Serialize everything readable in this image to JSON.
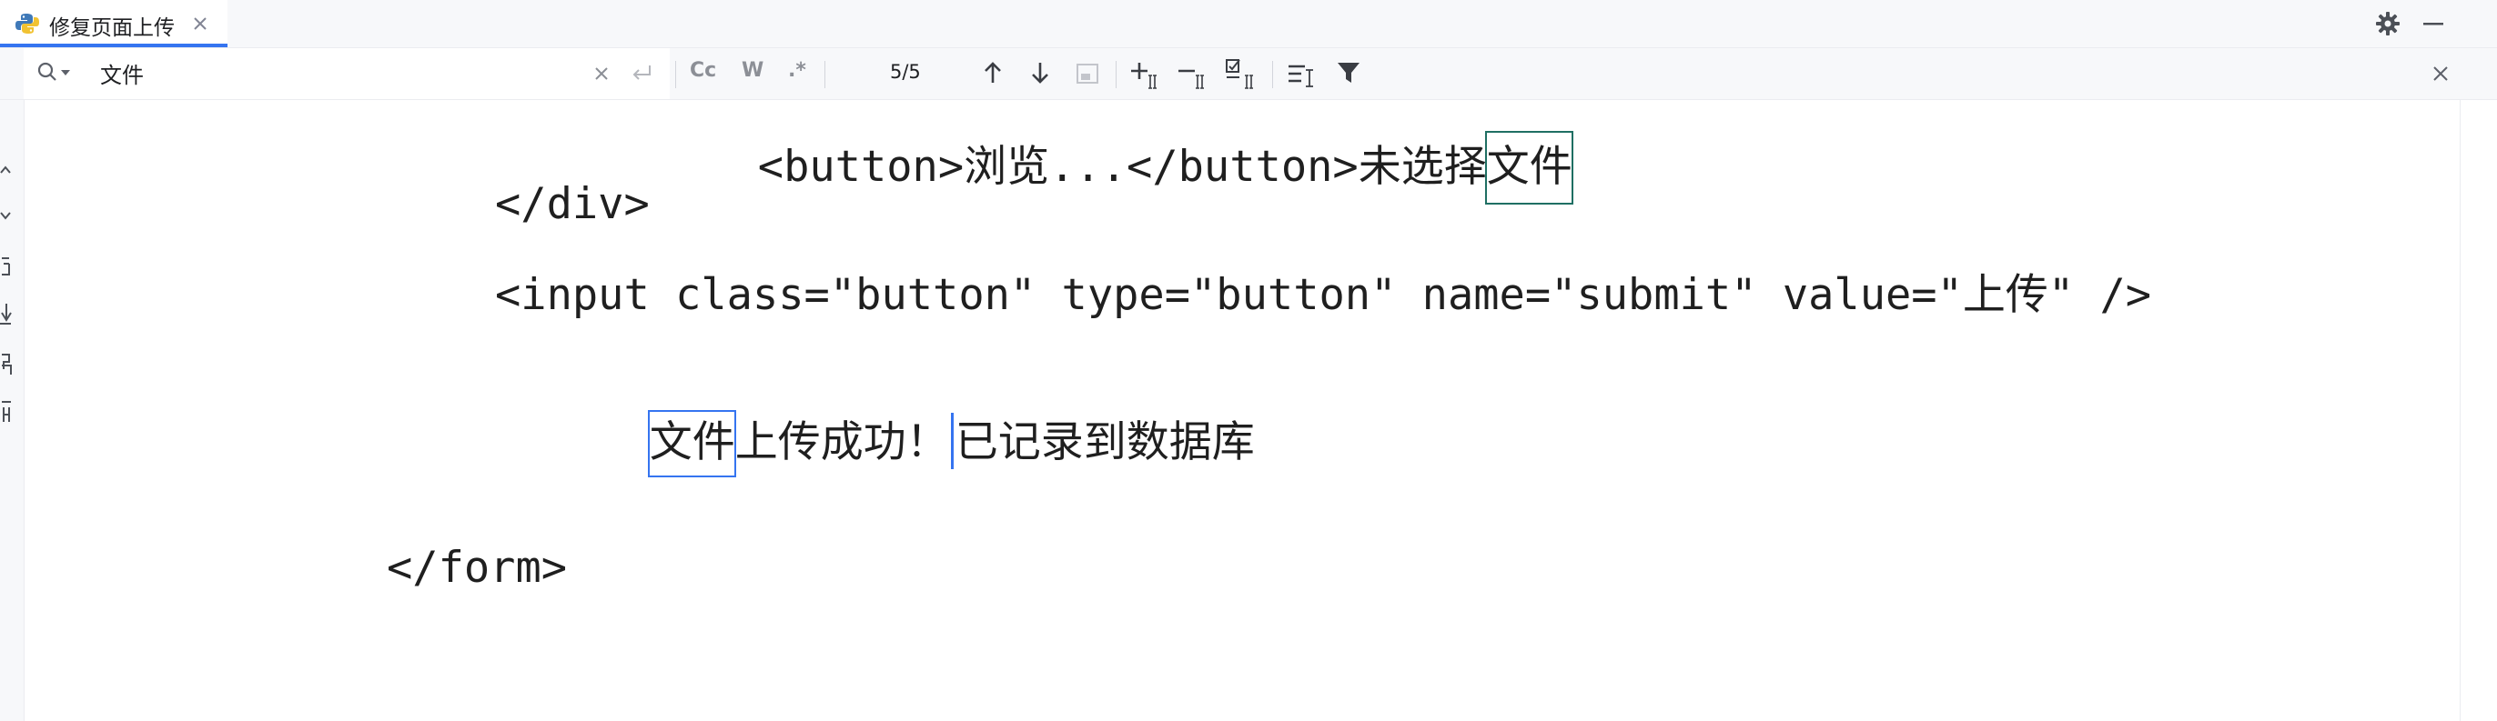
{
  "tab": {
    "icon": "python-file-icon",
    "label": "修复页面上传"
  },
  "find": {
    "query": "文件",
    "match_count": "5/5",
    "case_label": "Cc",
    "words_label": "W",
    "regex_label": ".*"
  },
  "code": {
    "line1": {
      "before": "<button>浏览...</button>未选择",
      "match": "文件"
    },
    "line2": "</div>",
    "line3": "<input class=\"button\" type=\"button\" name=\"submit\" value=\"上传\" />",
    "line4": {
      "match": "文件",
      "before_caret": "上传成功！",
      "after_caret": "已记录到数据库"
    },
    "line5": "</form>"
  },
  "colors": {
    "accent": "#3574f0",
    "other_match": "#1f6f63",
    "text": "#1f1f1f",
    "panel": "#f7f8fa"
  }
}
